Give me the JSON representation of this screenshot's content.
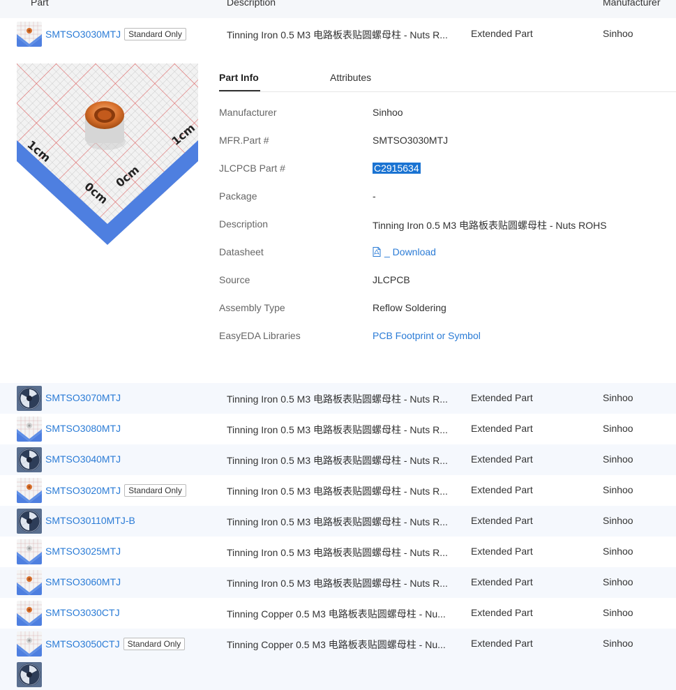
{
  "columns": {
    "part": "Part",
    "description": "Description",
    "manufacturer": "Manufacturer"
  },
  "expanded_row": {
    "part_number": "SMTSO3030MTJ",
    "badge": "Standard Only",
    "description": "Tinning Iron 0.5 M3 电路板表贴圆螺母柱 - Nuts R...",
    "type": "Extended Part",
    "manufacturer": "Sinhoo"
  },
  "product_image": {
    "label_1cm_left": "1cm",
    "label_1cm_right": "1cm",
    "label_0cm_left": "0cm",
    "label_0cm_right": "0cm"
  },
  "detail_tabs": {
    "part_info": "Part Info",
    "attributes": "Attributes"
  },
  "part_info": [
    {
      "label": "Manufacturer",
      "value": "Sinhoo"
    },
    {
      "label": "MFR.Part #",
      "value": "SMTSO3030MTJ"
    },
    {
      "label": "JLCPCB Part #",
      "value": "C2915634"
    },
    {
      "label": "Package",
      "value": "-"
    },
    {
      "label": "Description",
      "value": "Tinning Iron 0.5 M3 电路板表贴圆螺母柱 - Nuts ROHS"
    },
    {
      "label": "Datasheet",
      "value": "_ Download"
    },
    {
      "label": "Source",
      "value": "JLCPCB"
    },
    {
      "label": "Assembly Type",
      "value": "Reflow Soldering"
    },
    {
      "label": "EasyEDA Libraries",
      "value": "PCB Footprint or Symbol"
    }
  ],
  "rows": [
    {
      "part_number": "SMTSO3070MTJ",
      "badge": "",
      "description": "Tinning Iron 0.5 M3 电路板表贴圆螺母柱 - Nuts R...",
      "type": "Extended Part",
      "manufacturer": "Sinhoo",
      "thumb": "reel"
    },
    {
      "part_number": "SMTSO3080MTJ",
      "badge": "",
      "description": "Tinning Iron 0.5 M3 电路板表贴圆螺母柱 - Nuts R...",
      "type": "Extended Part",
      "manufacturer": "Sinhoo",
      "thumb": "grid-silver"
    },
    {
      "part_number": "SMTSO3040MTJ",
      "badge": "",
      "description": "Tinning Iron 0.5 M3 电路板表贴圆螺母柱 - Nuts R...",
      "type": "Extended Part",
      "manufacturer": "Sinhoo",
      "thumb": "reel"
    },
    {
      "part_number": "SMTSO3020MTJ",
      "badge": "Standard Only",
      "description": "Tinning Iron 0.5 M3 电路板表贴圆螺母柱 - Nuts R...",
      "type": "Extended Part",
      "manufacturer": "Sinhoo",
      "thumb": "grid-copper"
    },
    {
      "part_number": "SMTSO30110MTJ-B",
      "badge": "",
      "description": "Tinning Iron 0.5 M3 电路板表贴圆螺母柱 - Nuts R...",
      "type": "Extended Part",
      "manufacturer": "Sinhoo",
      "thumb": "reel"
    },
    {
      "part_number": "SMTSO3025MTJ",
      "badge": "",
      "description": "Tinning Iron 0.5 M3 电路板表贴圆螺母柱 - Nuts R...",
      "type": "Extended Part",
      "manufacturer": "Sinhoo",
      "thumb": "grid-silver"
    },
    {
      "part_number": "SMTSO3060MTJ",
      "badge": "",
      "description": "Tinning Iron 0.5 M3 电路板表贴圆螺母柱 - Nuts R...",
      "type": "Extended Part",
      "manufacturer": "Sinhoo",
      "thumb": "grid-copper"
    },
    {
      "part_number": "SMTSO3030CTJ",
      "badge": "",
      "description": "Tinning Copper 0.5 M3 电路板表贴圆螺母柱 - Nu...",
      "type": "Extended Part",
      "manufacturer": "Sinhoo",
      "thumb": "grid-copper"
    },
    {
      "part_number": "SMTSO3050CTJ",
      "badge": "Standard Only",
      "description": "Tinning Copper 0.5 M3 电路板表贴圆螺母柱 - Nu...",
      "type": "Extended Part",
      "manufacturer": "Sinhoo",
      "thumb": "grid-silver"
    }
  ],
  "colors": {
    "link": "#2a7bd6",
    "selection": "#1a73d2",
    "row_alt": "#f5f8fd"
  }
}
